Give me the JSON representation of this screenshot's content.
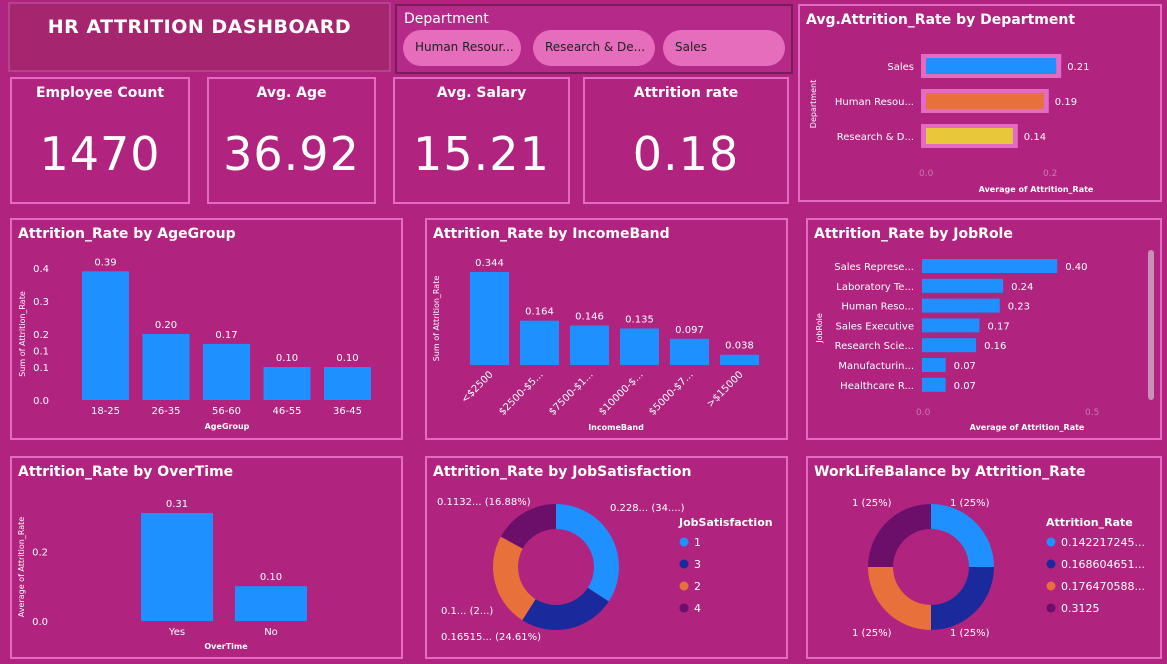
{
  "header": {
    "title": "HR ATTRITION DASHBOARD"
  },
  "slicer": {
    "title": "Department",
    "options": [
      "Human Resour...",
      "Research & De...",
      "Sales"
    ]
  },
  "kpis": [
    {
      "label": "Employee Count",
      "value": "1470"
    },
    {
      "label": "Avg. Age",
      "value": "36.92"
    },
    {
      "label": "Avg. Salary",
      "value": "15.21"
    },
    {
      "label": "Attrition rate",
      "value": "0.18"
    }
  ],
  "colors": {
    "blue": "#1e90ff",
    "navy": "#1a2a9c",
    "orange": "#e8703a",
    "purple": "#6b0f6b",
    "yellow": "#e8c83a",
    "bar_bg": "#e46bc4"
  },
  "chart_data": [
    {
      "id": "dept",
      "type": "bar",
      "orientation": "horizontal",
      "title": "Avg.Attrition_Rate by Department",
      "ylabel": "Department",
      "xlabel": "Average of Attrition_Rate",
      "categories": [
        "Sales",
        "Human Resou...",
        "Research & D..."
      ],
      "values": [
        0.21,
        0.19,
        0.14
      ],
      "labels": [
        "0.21",
        "0.19",
        "0.14"
      ],
      "bar_colors": [
        "#1e90ff",
        "#e8703a",
        "#e8c83a"
      ],
      "xticks": [
        "0.0",
        "0.2"
      ],
      "xlim": [
        0,
        0.2
      ]
    },
    {
      "id": "age",
      "type": "bar",
      "title": "Attrition_Rate by AgeGroup",
      "xlabel": "AgeGroup",
      "ylabel": "Sum of Attrition_Rate",
      "categories": [
        "18-25",
        "26-35",
        "56-60",
        "46-55",
        "36-45"
      ],
      "values": [
        0.39,
        0.2,
        0.17,
        0.1,
        0.1
      ],
      "labels": [
        "0.39",
        "0.20",
        "0.17",
        "0.10",
        "0.10"
      ],
      "yticks": [
        "0.0",
        "0.1",
        "0.1",
        "0.2",
        "0.3",
        "0.4"
      ],
      "ytick_values": [
        0,
        0.1,
        0.15,
        0.2,
        0.3,
        0.4
      ],
      "ylim": [
        0,
        0.4
      ]
    },
    {
      "id": "income",
      "type": "bar",
      "title": "Attrition_Rate by IncomeBand",
      "xlabel": "IncomeBand",
      "ylabel": "Sum of Attrition_Rate",
      "categories": [
        "<$2500",
        "$2500-$5...",
        "$7500-$1...",
        "$10000-$...",
        "$5000-$7...",
        ">$15000"
      ],
      "values": [
        0.344,
        0.164,
        0.146,
        0.135,
        0.097,
        0.038
      ],
      "labels": [
        "0.344",
        "0.164",
        "0.146",
        "0.135",
        "0.097",
        "0.038"
      ],
      "ylim": [
        0,
        0.344
      ]
    },
    {
      "id": "jobrole",
      "type": "bar",
      "orientation": "horizontal",
      "title": "Attrition_Rate by JobRole",
      "ylabel": "JobRole",
      "xlabel": "Average of Attrition_Rate",
      "categories": [
        "Sales Represe...",
        "Laboratory Te...",
        "Human Reso...",
        "Sales Executive",
        "Research Scie...",
        "Manufacturin...",
        "Healthcare R..."
      ],
      "values": [
        0.4,
        0.24,
        0.23,
        0.17,
        0.16,
        0.07,
        0.07
      ],
      "labels": [
        "0.40",
        "0.24",
        "0.23",
        "0.17",
        "0.16",
        "0.07",
        "0.07"
      ],
      "xticks": [
        "0.0",
        "0.5"
      ],
      "xlim": [
        0,
        0.5
      ]
    },
    {
      "id": "overtime",
      "type": "bar",
      "title": "Attrition_Rate by OverTime",
      "xlabel": "OverTime",
      "ylabel": "Average of Attrition_Rate",
      "categories": [
        "Yes",
        "No"
      ],
      "values": [
        0.31,
        0.1
      ],
      "labels": [
        "0.31",
        "0.10"
      ],
      "yticks": [
        "0.0",
        "0.2"
      ],
      "ytick_values": [
        0,
        0.2
      ],
      "ylim": [
        0,
        0.31
      ]
    },
    {
      "id": "jobsat",
      "type": "pie",
      "donut": true,
      "title": "Attrition_Rate by JobSatisfaction",
      "legend_title": "JobSatisfaction",
      "legend": [
        "1",
        "3",
        "2",
        "4"
      ],
      "values": [
        0.228,
        0.1651,
        0.16,
        0.1132
      ],
      "colors": [
        "#1e90ff",
        "#1a2a9c",
        "#e8703a",
        "#6b0f6b"
      ],
      "data_labels": [
        "0.228... (34....)",
        "0.16515... (24.61%)",
        "0.1... (2...)",
        "0.1132... (16.88%)"
      ]
    },
    {
      "id": "wlb",
      "type": "pie",
      "donut": true,
      "title": "WorkLifeBalance by Attrition_Rate",
      "legend_title": "Attrition_Rate",
      "legend": [
        "0.142217245...",
        "0.168604651...",
        "0.176470588...",
        "0.3125"
      ],
      "values": [
        1,
        1,
        1,
        1
      ],
      "colors": [
        "#1e90ff",
        "#1a2a9c",
        "#e8703a",
        "#6b0f6b"
      ],
      "data_labels": [
        "1 (25%)",
        "1 (25%)",
        "1 (25%)",
        "1 (25%)"
      ]
    }
  ]
}
